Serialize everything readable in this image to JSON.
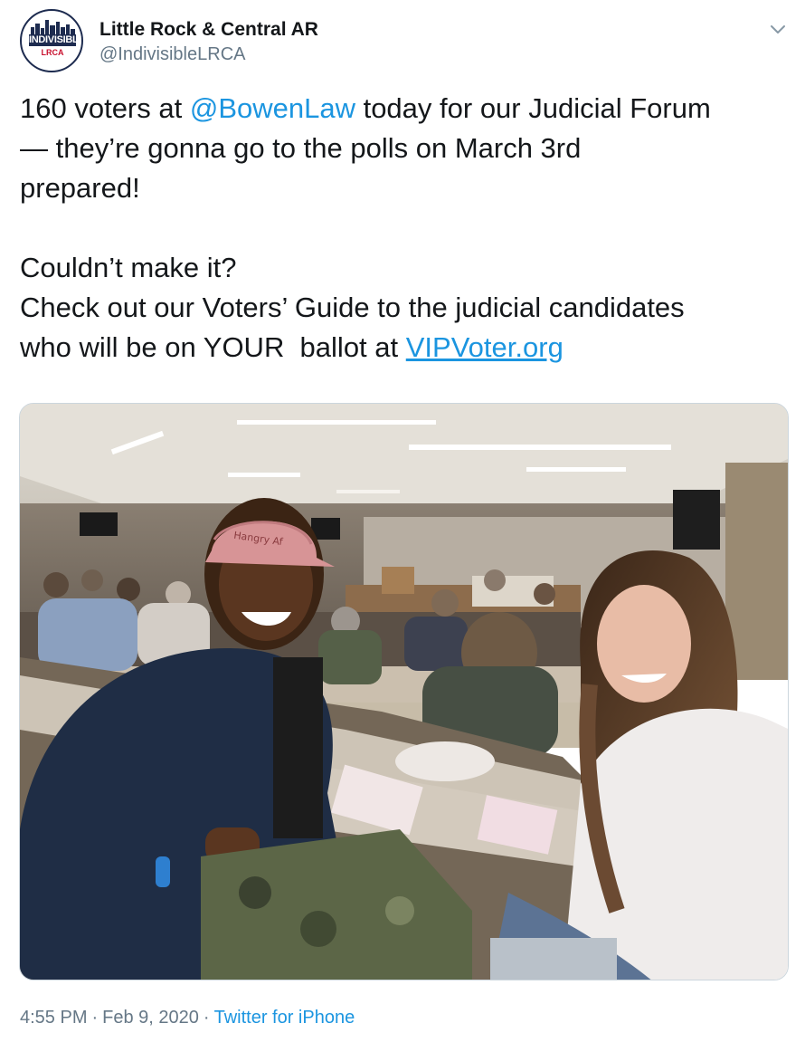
{
  "author": {
    "name": "Little Rock & Central AR",
    "handle": "@IndivisibleLRCA",
    "avatar_text_top": "INDIVISIBLE",
    "avatar_text_bottom": "LRCA",
    "avatar_colors": {
      "navy": "#1d2b4f",
      "red": "#c8102e"
    }
  },
  "tweet": {
    "line1_pre": "160 voters at ",
    "mention": "@BowenLaw",
    "line1_post": " today for our Judicial Forum",
    "line2": "— they’re gonna go to the polls on March 3rd",
    "line3": "prepared!",
    "line4": "Couldn’t make it?",
    "line5": "Check out our Voters’ Guide to the judicial candidates",
    "line6_pre": "who will be on YOUR  ballot at ",
    "link": "VIPVoter.org"
  },
  "media": {
    "cap_text": "Hangry Af",
    "icon": "photo"
  },
  "footer": {
    "time": "4:55 PM",
    "date": "Feb 9, 2020",
    "separator": "·",
    "source": "Twitter for iPhone"
  },
  "colors": {
    "link": "#1b95e0",
    "secondary_text": "#657786",
    "primary_text": "#14171a"
  },
  "icons": {
    "menu": "chevron-down-icon"
  }
}
